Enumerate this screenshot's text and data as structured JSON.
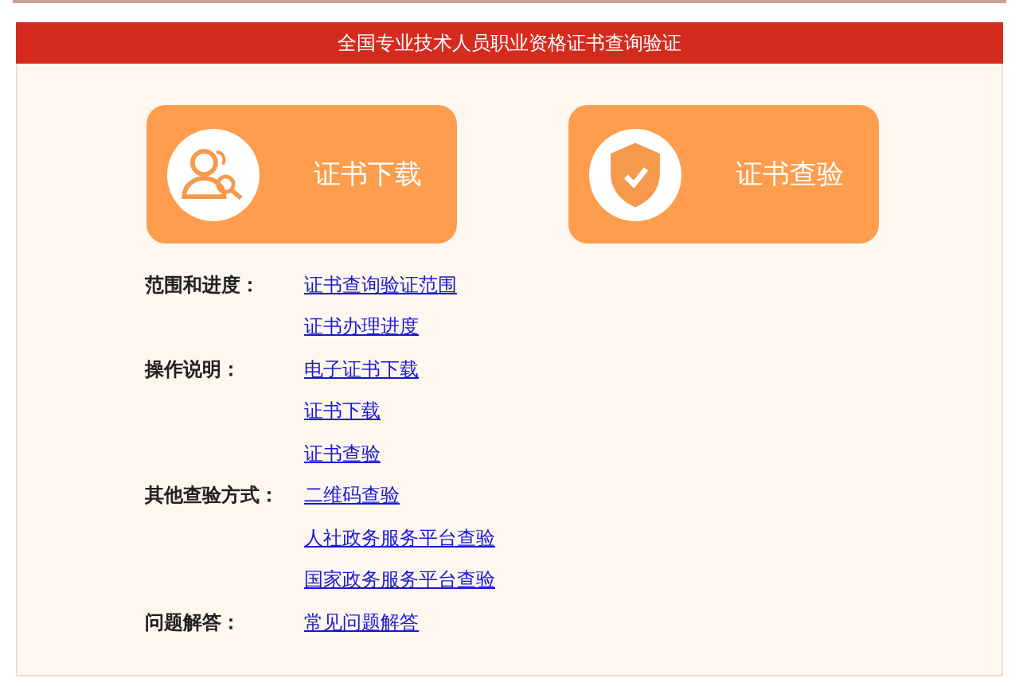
{
  "header": {
    "title": "全国专业技术人员职业资格证书查询验证"
  },
  "cards": [
    {
      "kind": "person-search",
      "label": "证书下载"
    },
    {
      "kind": "shield-check",
      "label": "证书查验"
    }
  ],
  "sections": [
    {
      "label": "范围和进度：",
      "links": [
        "证书查询验证范围",
        "证书办理进度"
      ]
    },
    {
      "label": "操作说明：",
      "links": [
        "电子证书下载",
        "证书下载",
        "证书查验"
      ]
    },
    {
      "label": "其他查验方式：",
      "links": [
        "二维码查验",
        "人社政务服务平台查验",
        "国家政务服务平台查验"
      ]
    },
    {
      "label": "问题解答：",
      "links": [
        "常见问题解答"
      ]
    }
  ]
}
